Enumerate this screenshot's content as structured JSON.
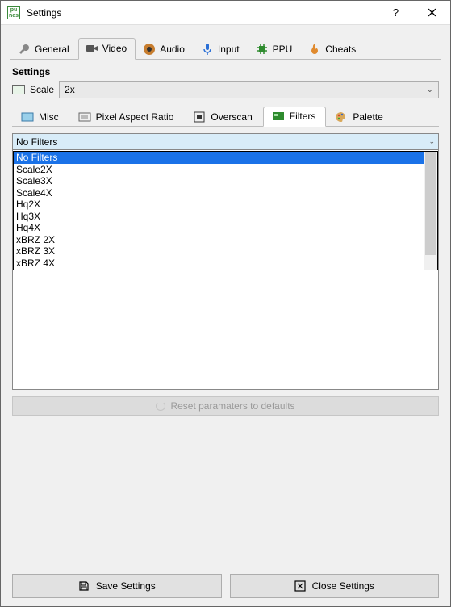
{
  "window": {
    "title": "Settings"
  },
  "main_tabs": {
    "general": "General",
    "video": "Video",
    "audio": "Audio",
    "input": "Input",
    "ppu": "PPU",
    "cheats": "Cheats",
    "active": "video"
  },
  "settings": {
    "header": "Settings",
    "scale_label": "Scale",
    "scale_value": "2x"
  },
  "sub_tabs": {
    "misc": "Misc",
    "par": "Pixel Aspect Ratio",
    "overscan": "Overscan",
    "filters": "Filters",
    "palette": "Palette",
    "active": "filters"
  },
  "filters": {
    "selected": "No Filters",
    "options": [
      "No Filters",
      "Scale2X",
      "Scale3X",
      "Scale4X",
      "Hq2X",
      "Hq3X",
      "Hq4X",
      "xBRZ 2X",
      "xBRZ 3X",
      "xBRZ 4X"
    ],
    "highlight_index": 0
  },
  "reset": {
    "label": "Reset paramaters to defaults"
  },
  "buttons": {
    "save": "Save Settings",
    "close": "Close Settings"
  }
}
